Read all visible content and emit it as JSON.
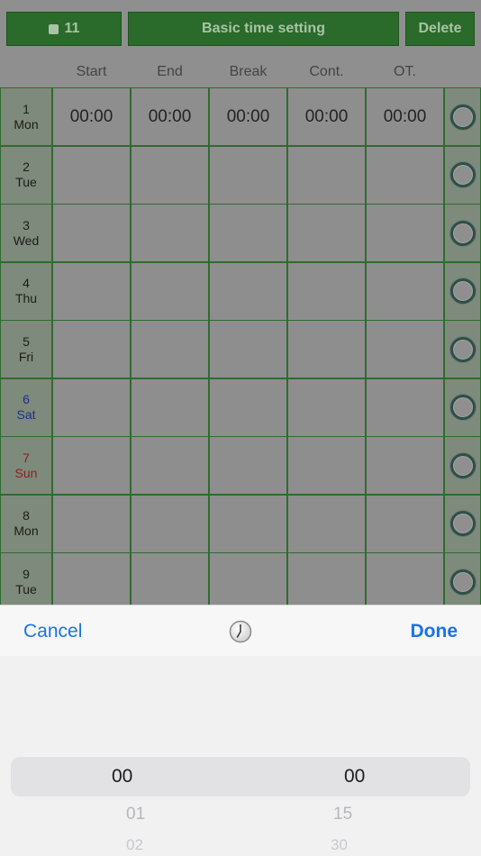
{
  "header": {
    "month": "11",
    "title": "Basic time setting",
    "delete_label": "Delete"
  },
  "columns": [
    "Start",
    "End",
    "Break",
    "Cont.",
    "OT."
  ],
  "rows": [
    {
      "num": "1",
      "day": "Mon",
      "type": "weekday",
      "values": [
        "00:00",
        "00:00",
        "00:00",
        "00:00",
        "00:00"
      ]
    },
    {
      "num": "2",
      "day": "Tue",
      "type": "weekday",
      "values": [
        "",
        "",
        "",
        "",
        ""
      ]
    },
    {
      "num": "3",
      "day": "Wed",
      "type": "weekday",
      "values": [
        "",
        "",
        "",
        "",
        ""
      ]
    },
    {
      "num": "4",
      "day": "Thu",
      "type": "weekday",
      "values": [
        "",
        "",
        "",
        "",
        ""
      ]
    },
    {
      "num": "5",
      "day": "Fri",
      "type": "weekday",
      "values": [
        "",
        "",
        "",
        "",
        ""
      ]
    },
    {
      "num": "6",
      "day": "Sat",
      "type": "sat",
      "values": [
        "",
        "",
        "",
        "",
        ""
      ]
    },
    {
      "num": "7",
      "day": "Sun",
      "type": "sun",
      "values": [
        "",
        "",
        "",
        "",
        ""
      ]
    },
    {
      "num": "8",
      "day": "Mon",
      "type": "weekday",
      "values": [
        "",
        "",
        "",
        "",
        ""
      ]
    },
    {
      "num": "9",
      "day": "Tue",
      "type": "weekday",
      "values": [
        "",
        "",
        "",
        "",
        ""
      ]
    }
  ],
  "picker": {
    "cancel_label": "Cancel",
    "done_label": "Done",
    "hours": [
      "00",
      "01",
      "02"
    ],
    "minutes": [
      "00",
      "15",
      "30"
    ]
  },
  "colors": {
    "header_green": "#2a6a2a",
    "link_blue": "#1a73e8",
    "sat_blue": "#1e2f8f",
    "sun_red": "#8a1f1f"
  }
}
